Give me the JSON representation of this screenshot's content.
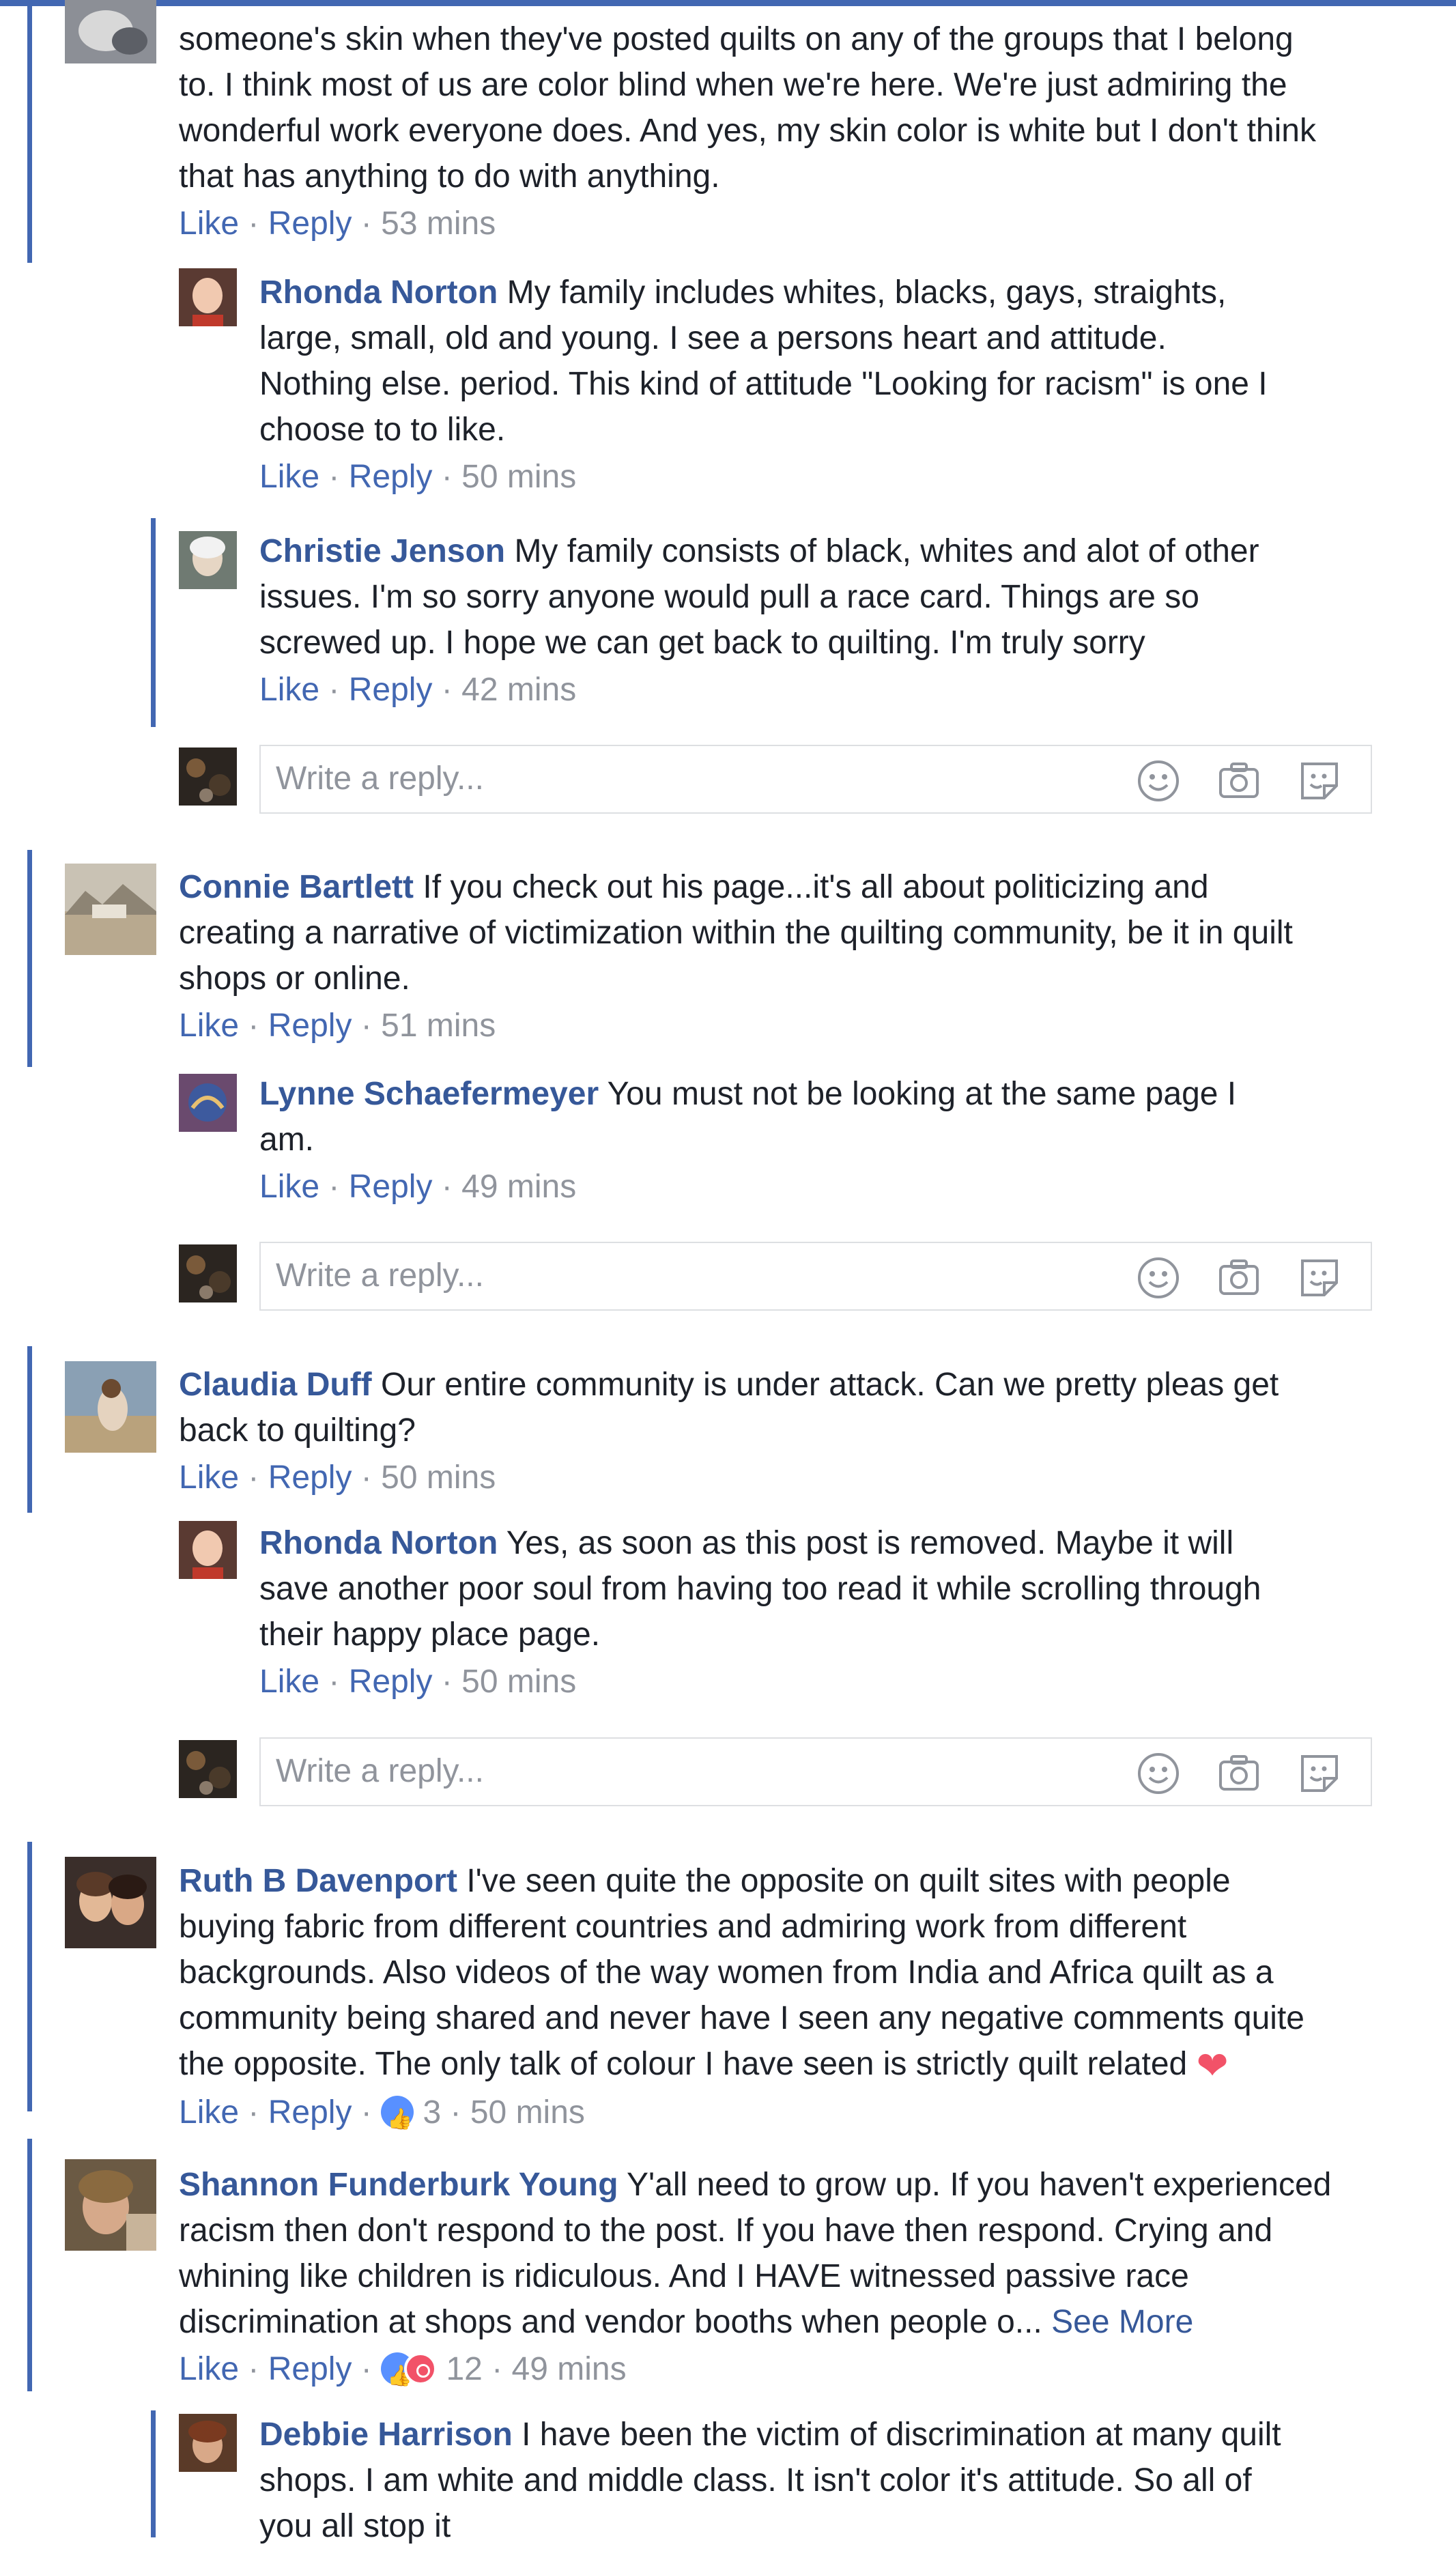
{
  "theme": {
    "accent": "#4267b2",
    "name_color": "#365899",
    "meta_color": "#90949c",
    "text_color": "#1d2129"
  },
  "labels": {
    "like": "Like",
    "reply": "Reply",
    "dot": "·",
    "write_reply": "Write a reply...",
    "see_more": "See More"
  },
  "icons": [
    "smiley-icon",
    "camera-icon",
    "sticker-icon"
  ],
  "comments": [
    {
      "text_lines": [
        "someone's skin when they've posted quilts on any of the groups that I belong",
        "to. I think most of us are color blind when we're here. We're just admiring the",
        "wonderful work everyone does. And yes, my skin color is white but I don't think",
        "that has anything to do with anything."
      ],
      "time": "53 mins",
      "replies": [
        {
          "author": "Rhonda Norton",
          "first_line": "My family includes whites, blacks, gays, straights,",
          "text_lines": [
            "large, small, old and young. I see a persons heart and attitude.",
            "Nothing else. period. This kind of attitude \"Looking for racism\" is one I",
            "choose to to like."
          ],
          "time": "50 mins"
        },
        {
          "author": "Christie Jenson",
          "first_line": "My family consists of black, whites and alot of other",
          "text_lines": [
            "issues. I'm so sorry anyone would pull a race card. Things are so",
            "screwed up. I hope we can get back to quilting. I'm truly sorry"
          ],
          "time": "42 mins"
        }
      ]
    },
    {
      "author": "Connie Bartlett",
      "first_line": "If you check out his page...it's all about politicizing and",
      "text_lines": [
        "creating a narrative of victimization within the quilting community, be it in quilt",
        "shops or online."
      ],
      "time": "51 mins",
      "replies": [
        {
          "author": "Lynne Schaefermeyer",
          "first_line": "You must not be looking at the same page I",
          "text_lines": [
            "am."
          ],
          "time": "49 mins"
        }
      ]
    },
    {
      "author": "Claudia Duff",
      "first_line": "Our entire community is under attack. Can we pretty pleas get",
      "text_lines": [
        "back to quilting?"
      ],
      "time": "50 mins",
      "replies": [
        {
          "author": "Rhonda Norton",
          "first_line": "Yes, as soon as this post is removed. Maybe it will",
          "text_lines": [
            "save another poor soul from having too read it while scrolling through",
            "their happy place page."
          ],
          "time": "50 mins"
        }
      ]
    },
    {
      "author": "Ruth B Davenport",
      "first_line": "I've seen quite the opposite on quilt sites with people",
      "text_lines": [
        "buying fabric from different countries and admiring work from different",
        "backgrounds. Also videos of the way women from India and Africa quilt as a",
        "community being shared and never have I seen any negative comments quite",
        "the opposite. The only talk of colour I have seen is strictly quilt related"
      ],
      "reactions": 3,
      "time": "50 mins"
    },
    {
      "author": "Shannon Funderburk Young",
      "first_line": "Y'all need to grow up. If you haven't experienced",
      "text_lines": [
        "racism then don't respond to the post. If you have then respond. Crying and",
        "whining like children is ridiculous. And I HAVE witnessed passive race",
        "discrimination at shops and vendor booths when people o..."
      ],
      "reactions": 12,
      "time": "49 mins",
      "replies": [
        {
          "author": "Debbie Harrison",
          "first_line": "I have been the victim of discrimination at many quilt",
          "text_lines": [
            "shops. I am white and middle class. It isn't color it's attitude. So all of",
            "you all stop it"
          ]
        }
      ]
    }
  ]
}
